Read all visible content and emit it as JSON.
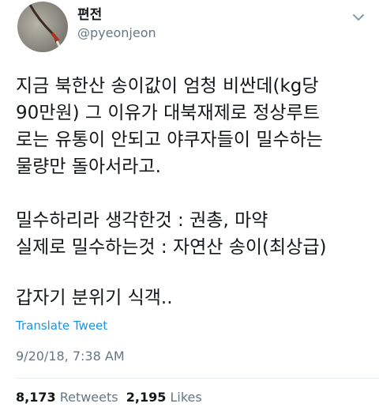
{
  "user": {
    "display_name": "편전",
    "handle": "@pyeonjeon"
  },
  "tweet": {
    "paragraphs": [
      [
        "지금 북한산 송이값이 엄청 비싼데(kg당",
        "90만원) 그 이유가 대북재제로 정상루트",
        "로는 유통이 안되고 야쿠자들이 밀수하는",
        "물량만 돌아서라고."
      ],
      [
        "밀수하리라 생각한것 : 권총, 마약",
        "실제로 밀수하는것 : 자연산 송이(최상급)"
      ],
      [
        "갑자기 분위기 식객.."
      ]
    ],
    "translate_label": "Translate Tweet",
    "timestamp": "9/20/18, 7:38 AM"
  },
  "stats": {
    "retweets_count": "8,173",
    "retweets_label": "Retweets",
    "likes_count": "2,195",
    "likes_label": "Likes"
  },
  "icons": {
    "more": "chevron-down-icon"
  },
  "colors": {
    "text": "#14171a",
    "secondary": "#657786",
    "link": "#1b95e0",
    "divider": "#e6ecf0"
  }
}
